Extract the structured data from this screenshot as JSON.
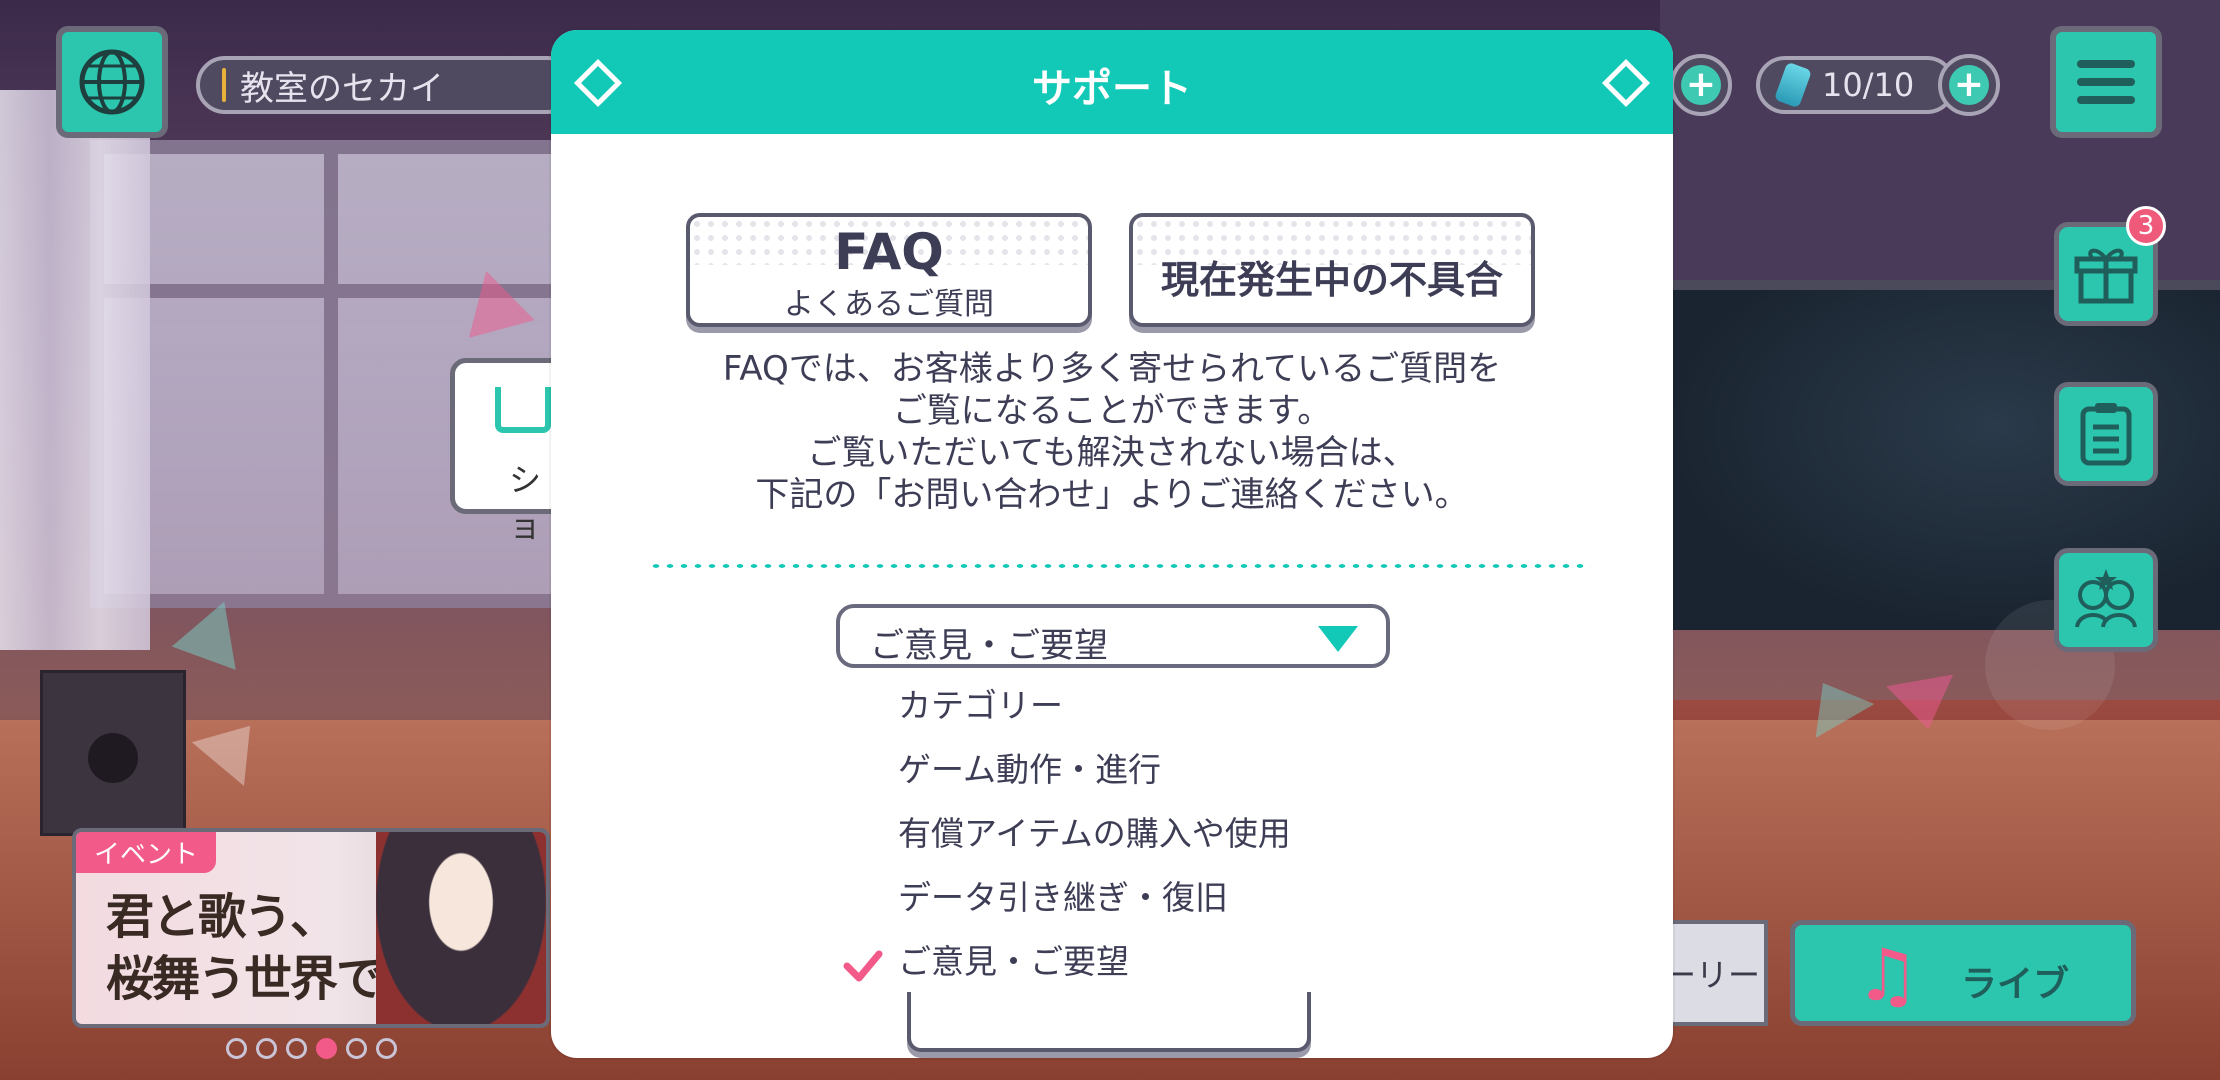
{
  "hud": {
    "location": "教室のセカイ",
    "stamina": "10/10",
    "gift_badge": "3"
  },
  "left": {
    "shop_label": "ショ"
  },
  "event": {
    "tag": "イベント",
    "title_line1": "君と歌う、",
    "title_line2": "桜舞う世界で",
    "page_dots": 6,
    "active_dot": 4
  },
  "bottom": {
    "story_label": "ーリー",
    "live_label": "ライブ"
  },
  "modal": {
    "title": "サポート",
    "faq_label": "FAQ",
    "faq_sublabel": "よくあるご質問",
    "bug_label": "現在発生中の不具合",
    "description": [
      "FAQでは、お客様より多く寄せられているご質問を",
      "ご覧になることができます。",
      "ご覧いただいても解決されない場合は、",
      "下記の「お問い合わせ」よりご連絡ください。"
    ],
    "select": {
      "value": "ご意見・ご要望",
      "options": [
        "カテゴリー",
        "ゲーム動作・進行",
        "有償アイテムの購入や使用",
        "データ引き継ぎ・復旧",
        "ご意見・ご要望"
      ],
      "selected_index": 4
    }
  },
  "colors": {
    "accent": "#12c8b6",
    "pink": "#f25a8a",
    "text": "#3d3d56"
  }
}
